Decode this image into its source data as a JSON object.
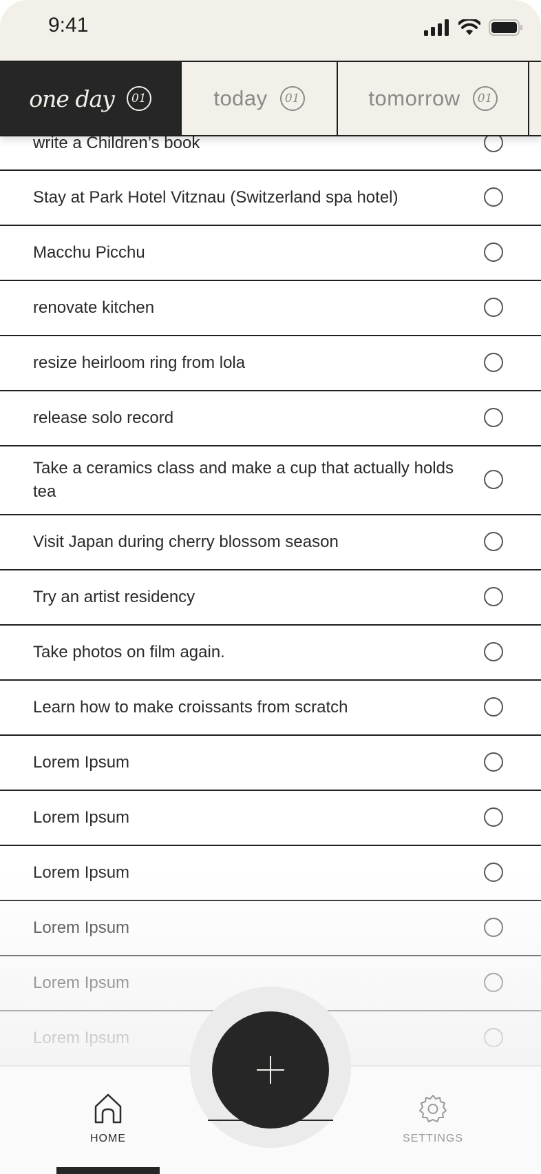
{
  "status_bar": {
    "time": "9:41"
  },
  "tabs": [
    {
      "label": "one day",
      "count": "01",
      "active": true
    },
    {
      "label": "today",
      "count": "01",
      "active": false
    },
    {
      "label": "tomorrow",
      "count": "01",
      "active": false
    }
  ],
  "items": [
    "write a Children’s book",
    "Stay at Park Hotel Vitznau (Switzerland spa hotel)",
    "Macchu Picchu",
    "renovate kitchen",
    "resize heirloom ring from lola",
    "release solo record",
    "Take a ceramics class and make a cup that actually holds tea",
    "Visit Japan during cherry blossom season",
    "Try an artist residency",
    "Take photos on film again.",
    "Learn how to make croissants from scratch",
    "Lorem Ipsum",
    "Lorem Ipsum",
    "Lorem Ipsum",
    "Lorem Ipsum",
    "Lorem Ipsum",
    "Lorem Ipsum"
  ],
  "bottom_nav": {
    "home_label": "HOME",
    "settings_label": "SETTINGS",
    "add_icon": "plus-icon"
  },
  "colors": {
    "dark": "#262626",
    "cream": "#f2f0e8",
    "muted": "#8a8a8a"
  }
}
